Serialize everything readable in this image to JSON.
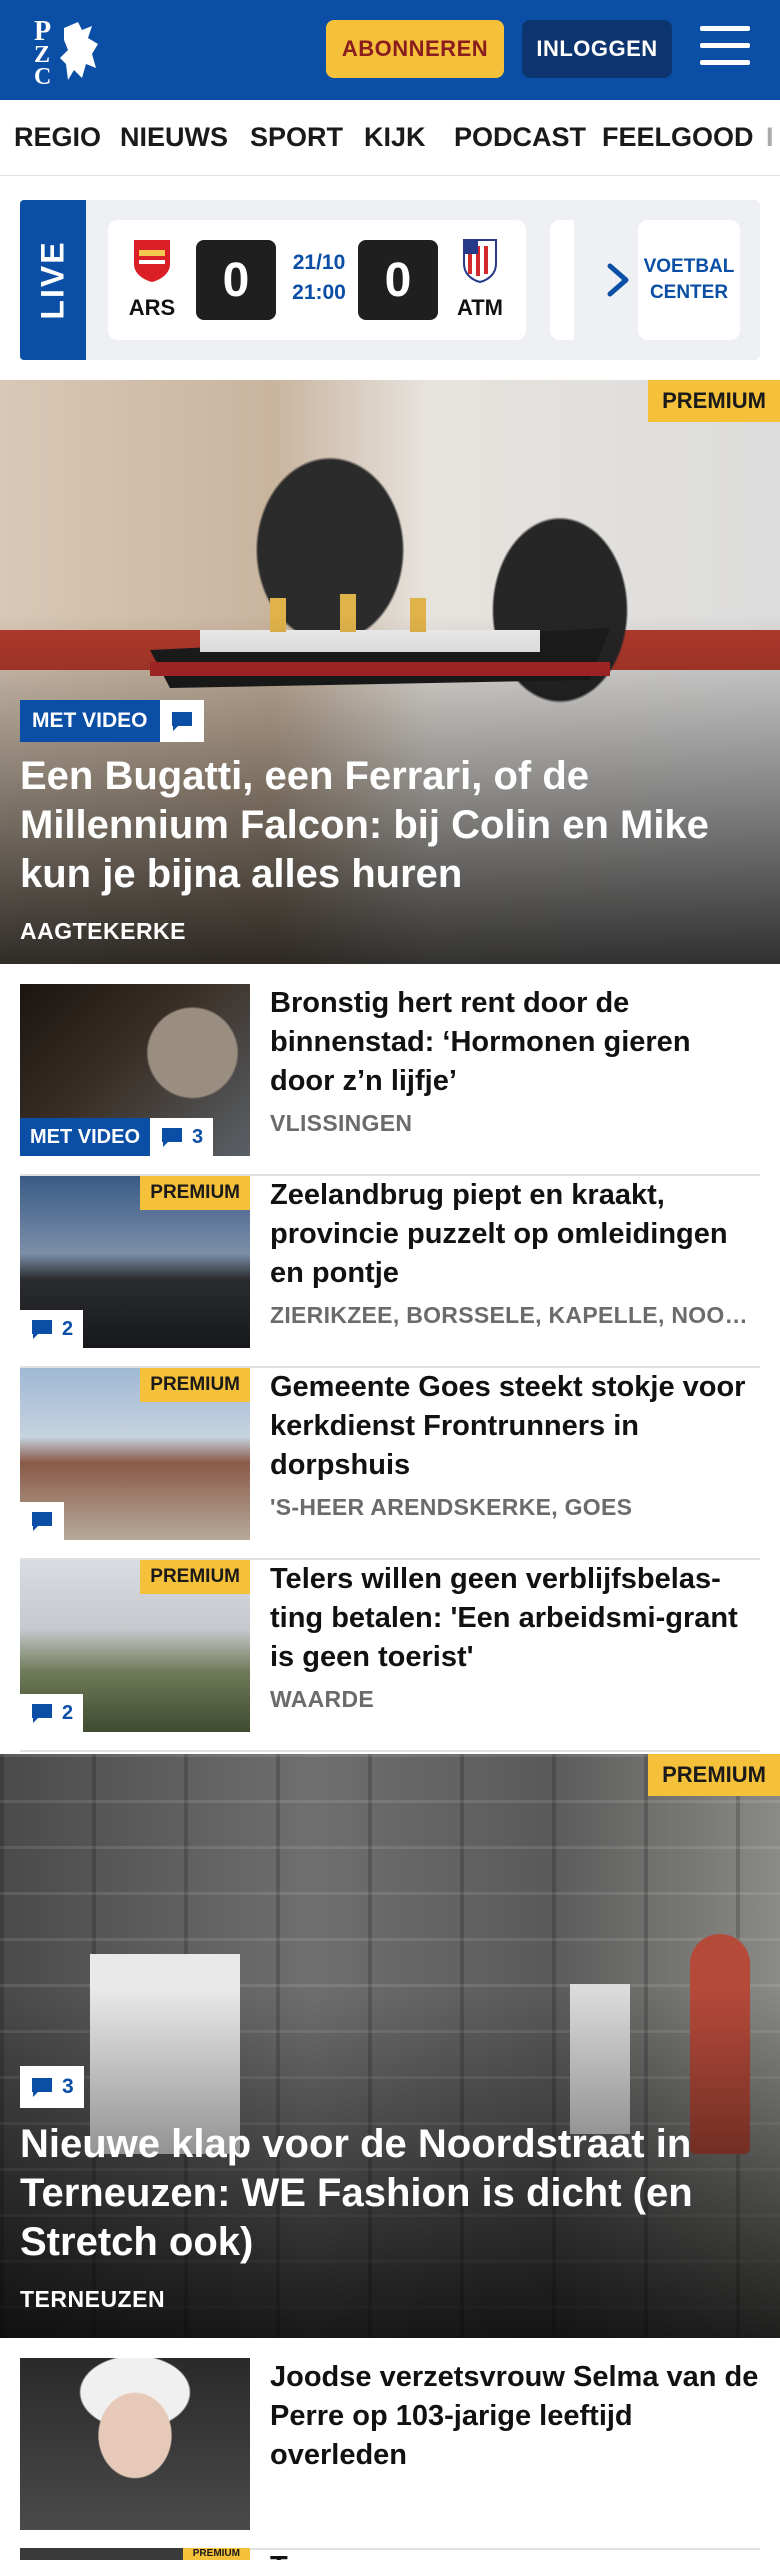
{
  "header": {
    "logo_letters": [
      "P",
      "Z",
      "C"
    ],
    "subscribe_label": "ABONNEREN",
    "login_label": "INLOGGEN",
    "colors": {
      "brand": "#0a4ea5",
      "accent": "#f5c13b"
    }
  },
  "nav": {
    "items": [
      "REGIO",
      "NIEUWS",
      "SPORT",
      "KIJK",
      "PODCAST",
      "FEELGOOD",
      "I"
    ]
  },
  "live": {
    "label": "LIVE",
    "match": {
      "home": "ARS",
      "away": "ATM",
      "home_score": "0",
      "away_score": "0",
      "date": "21/10",
      "time": "21:00"
    },
    "voetbal_center": [
      "VOETBAL",
      "CENTER"
    ]
  },
  "hero1": {
    "premium": "PREMIUM",
    "video": "MET VIDEO",
    "title": "Een Bugatti, een Ferrari, of de Millennium Falcon: bij Colin en Mike kun je bijna alles huren",
    "location": "AAGTEKERKE"
  },
  "articles": [
    {
      "title": "Bronstig hert rent door de binnenstad: ‘Hormonen gieren door z’n lijfje’",
      "location": "VLISSINGEN",
      "video": "MET VIDEO",
      "comments": "3",
      "premium": ""
    },
    {
      "title": "Zeelandbrug piept en kraakt, provincie puzzelt op omleidingen en pontje",
      "location": "ZIERIKZEE, BORSSELE, KAPELLE, NOORD-BEVELAND",
      "video": "",
      "comments": "2",
      "premium": "PREMIUM"
    },
    {
      "title": "Gemeente Goes steekt stokje voor kerkdienst Frontrunners in dorpshuis",
      "location": "'S-HEER ARENDSKERKE, GOES",
      "video": "",
      "comments": "",
      "premium": "PREMIUM"
    },
    {
      "title": "Telers willen geen verblijfsbelas-ting betalen: 'Een arbeidsmi-grant is geen toerist'",
      "location": "WAARDE",
      "video": "",
      "comments": "2",
      "premium": "PREMIUM"
    }
  ],
  "hero2": {
    "premium": "PREMIUM",
    "comments": "3",
    "title": "Nieuwe klap voor de Noordstraat in Terneuzen: WE Fashion is dicht (en Stretch ook)",
    "location": "TERNEUZEN"
  },
  "article_last": {
    "title": "Joodse verzetsvrouw Selma van de Perre op 103-jarige leeftijd overleden",
    "location": ""
  },
  "article_cut": {
    "premium": "PREMIUM",
    "title": "T"
  }
}
